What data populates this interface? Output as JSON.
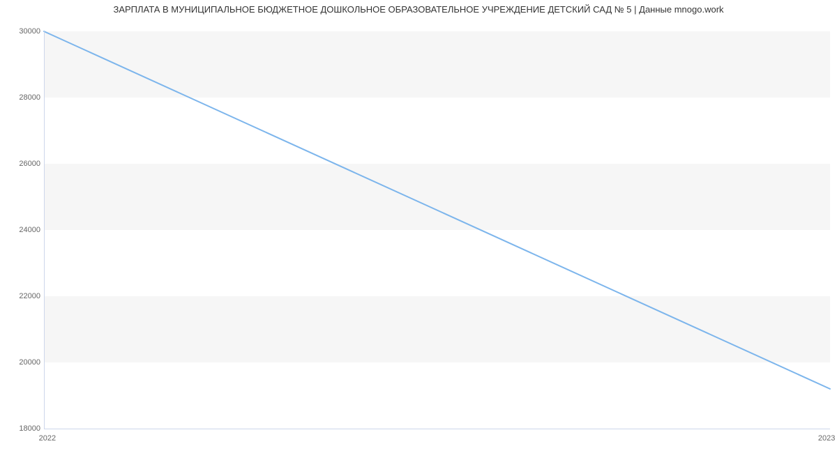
{
  "chart_data": {
    "type": "line",
    "title": "ЗАРПЛАТА В МУНИЦИПАЛЬНОЕ БЮДЖЕТНОЕ ДОШКОЛЬНОЕ ОБРАЗОВАТЕЛЬНОЕ УЧРЕЖДЕНИЕ ДЕТСКИЙ САД № 5 | Данные mnogo.work",
    "xlabel": "",
    "ylabel": "",
    "x_ticks": [
      "2022",
      "2023"
    ],
    "y_ticks": [
      18000,
      20000,
      22000,
      24000,
      26000,
      28000,
      30000
    ],
    "ylim": [
      18000,
      30000
    ],
    "categories": [
      "2022",
      "2023"
    ],
    "values": [
      30000,
      19200
    ],
    "series_color": "#7cb5ec"
  }
}
